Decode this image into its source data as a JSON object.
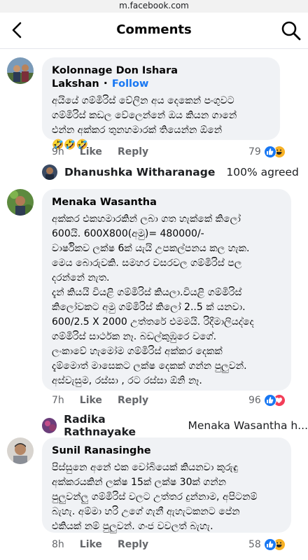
{
  "url": "m.facebook.com",
  "header": {
    "title": "Comments"
  },
  "comments": [
    {
      "author": "Kolonnage Don Ishara Lakshan",
      "follow": "Follow",
      "text": "අයියේ ගම්මිරිස් වේලින අය දෙකෙන් පංගුවට\nගම්මිරිස් කඩල වේලෙන්නේ  ඔය කියන ගානේ\nඑන්න අක්කර තුනහමාරක් තියෙන්න ඕනේ\n🤣🤣🤣",
      "time": "9h",
      "like": "Like",
      "reply": "Reply",
      "count": "79"
    },
    {
      "author": "Menaka Wasantha",
      "text": "අක්කර එකහමාරකින් ලබා ගත හැක්කේ කිලෝ\n600යි. 600X800(අමු)= 480000/-\nවාර්ෂිකව ලක්ෂ 6ක් යැයි උපකල්පනය කල හැක.\nමෙය බොරුවකි. සමහර වසරවල ගම්මිරිස් පල\nදරන්නේ නැත.\nදැන් කියයි වියළි ගම්මිරිස් කියලා.වියළි ගම්මිරිස්\nකිලෝවකට අමු ගම්මිරිස් කිලෝ 2..5 ක් යනවා.\n600/2.5 X 2000 උත්තරේ එමමයි. රිදීමාලියද්දෙ\nගම්මිරිස් සාර්ථක නෑ. බඩල්කුඹුරෙ වගේ.\nලංකාවේ හැමෝම ගම්මිරිස් අක්කර දෙකක්\nදැම්මොත් මාසෙකට ලක්ෂ දෙකක් ගන්න පුලුවන්.\nඅස්වැසුම, රස්සා , රට රස්සා ඕනි නෑ.",
      "time": "7h",
      "like": "Like",
      "reply": "Reply",
      "count": "96"
    },
    {
      "author": "Sunil Ranasinghe",
      "text": "පිස්සුනෙ අනේ එක වෝබියෙක් කියනවා කුරුඳු\nඅක්කරයකින් ලක්ෂ 15ක් ලක්ෂ 30ක් ගන්න\nපුලුවන්ලු ගම්මිරිස් වලට උත්තර දුන්නාම, අපිටනම්\nබැහැ. අම්මා හරි උගේ ගැනී ඇහැටකනට පේන\nඑකියක් නම් පුලුවන්. ගංජ වවලත් බැහැ.",
      "time": "8h",
      "like": "Like",
      "reply": "Reply",
      "count": "58"
    }
  ],
  "replies": [
    {
      "name": "Dhanushka Witharanage",
      "text": "100% agreed"
    },
    {
      "name": "Radika Rathnayake",
      "text": "Menaka Wasantha h..."
    }
  ],
  "colors": {
    "like_blue": "#1877f2",
    "love_red": "#f33e58",
    "haha_yellow": "#f7b125",
    "bubble": "#f0f2f5"
  },
  "icons": [
    "back-arrow-icon",
    "search-icon",
    "like-reaction-icon",
    "haha-reaction-icon",
    "love-reaction-icon"
  ]
}
